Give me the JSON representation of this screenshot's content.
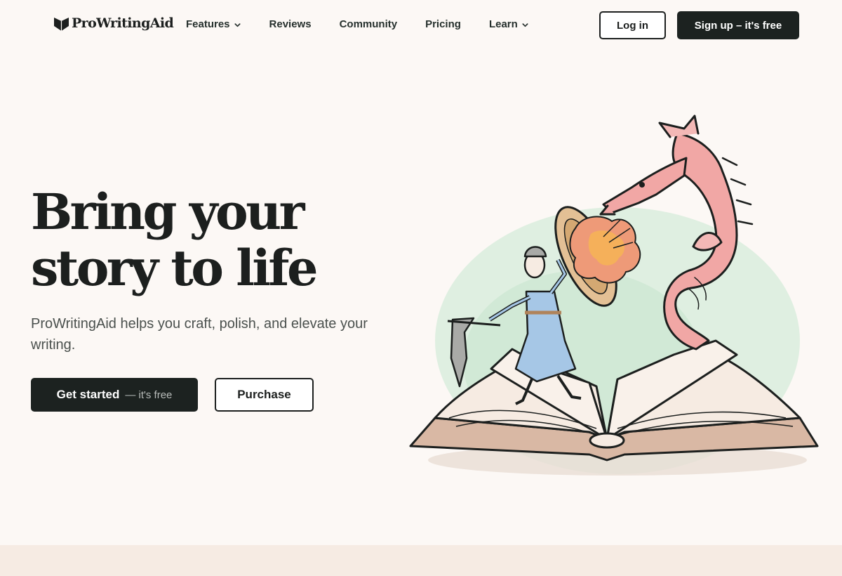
{
  "brand": {
    "name": "ProWritingAid",
    "logo_icon": "shield-book-icon"
  },
  "nav": {
    "items": [
      {
        "label": "Features",
        "has_dropdown": true
      },
      {
        "label": "Reviews",
        "has_dropdown": false
      },
      {
        "label": "Community",
        "has_dropdown": false
      },
      {
        "label": "Pricing",
        "has_dropdown": false
      },
      {
        "label": "Learn",
        "has_dropdown": true
      }
    ],
    "login_label": "Log in",
    "signup_label": "Sign up – it's free"
  },
  "hero": {
    "title_line1": "Bring your",
    "title_line2": "story to life",
    "subtitle": "ProWritingAid helps you craft, polish, and elevate your writing.",
    "cta_primary": "Get started",
    "cta_primary_suffix": "— it's free",
    "cta_secondary": "Purchase",
    "illustration": "knight-dragon-book-illustration"
  },
  "colors": {
    "background": "#fcf8f5",
    "dark": "#1c2220",
    "band": "#f6ebe3",
    "dragon": "#f1a7a5",
    "glow": "#cfe8d4"
  }
}
